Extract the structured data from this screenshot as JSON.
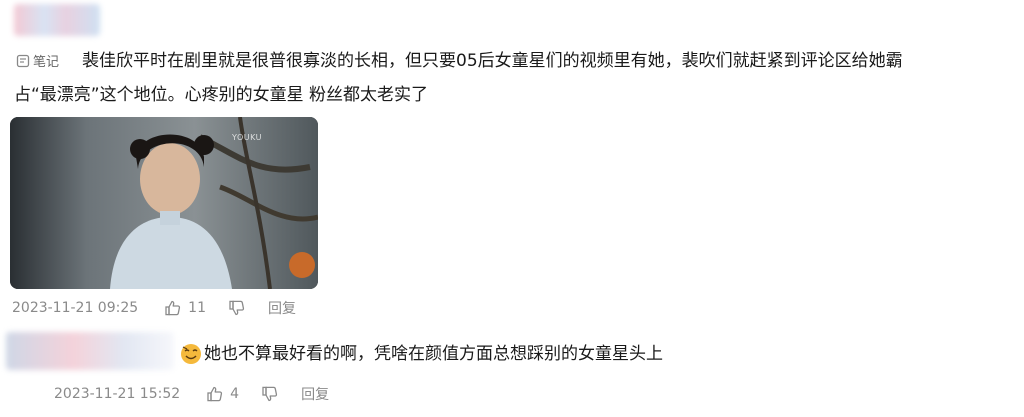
{
  "comments": [
    {
      "tag": "笔记",
      "text_line1": "裴佳欣平时在剧里就是很普很寡淡的长相，但只要05后女童星们的视频里有她，裴吹们就赶紧到评论区给她霸",
      "text_line2": "占“最漂亮”这个地位。心疼别的女童星 粉丝都太老实了",
      "video_watermark": "YOUKU",
      "timestamp": "2023-11-21 09:25",
      "likes": "11",
      "reply_label": "回复"
    },
    {
      "text": "她也不算最好看的啊，凭啥在颜值方面总想踩别的女童星头上",
      "timestamp": "2023-11-21 15:52",
      "likes": "4",
      "reply_label": "回复"
    }
  ],
  "icons": {
    "note": "note-icon",
    "like": "thumbs-up-icon",
    "dislike": "thumbs-down-icon",
    "emoji": "face-emoji-icon"
  },
  "colors": {
    "text": "#1a1a1a",
    "meta": "#8a8a8a",
    "emoji": "#f5b93c"
  }
}
